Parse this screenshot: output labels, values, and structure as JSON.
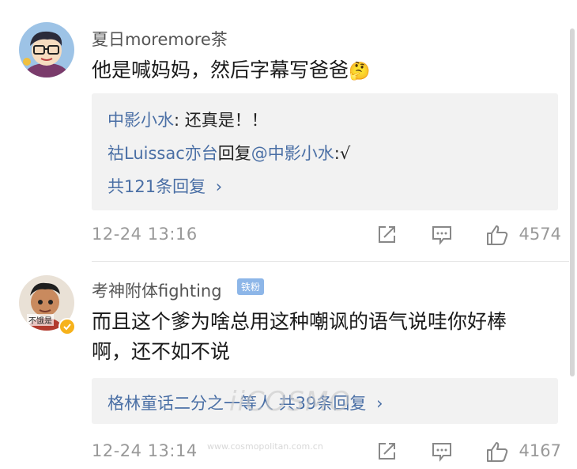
{
  "comments": [
    {
      "username": "夏日moremore茶",
      "text": "他是喊妈妈，然后字幕写爸爸",
      "emoji": "🤔",
      "replies": [
        {
          "user": "中影小水",
          "content": ": 还真是！！"
        },
        {
          "user": "祜Luissac亦台",
          "mid": "回复",
          "target": "@中影小水",
          "content": ":√"
        }
      ],
      "more_replies": "共121条回复",
      "time": "12-24 13:16",
      "likes": "4574"
    },
    {
      "username": "考神附体fighting",
      "badge": "铁粉",
      "text_line1": "而且这个爹为啥总用这种嘲讽的语气说哇你好棒",
      "text_line2": "啊，还不如不说",
      "avatar_label": "不饿是",
      "more_replies": "格林童话二分之一等人 共39条回复",
      "time": "12-24 13:14",
      "likes": "4167"
    }
  ],
  "watermark": {
    "text": "iiCOSMO",
    "sub": "www.cosmopolitan.com.cn"
  },
  "icons": {
    "share": "share-icon",
    "comment": "comment-icon",
    "like": "thumbs-up-icon"
  }
}
